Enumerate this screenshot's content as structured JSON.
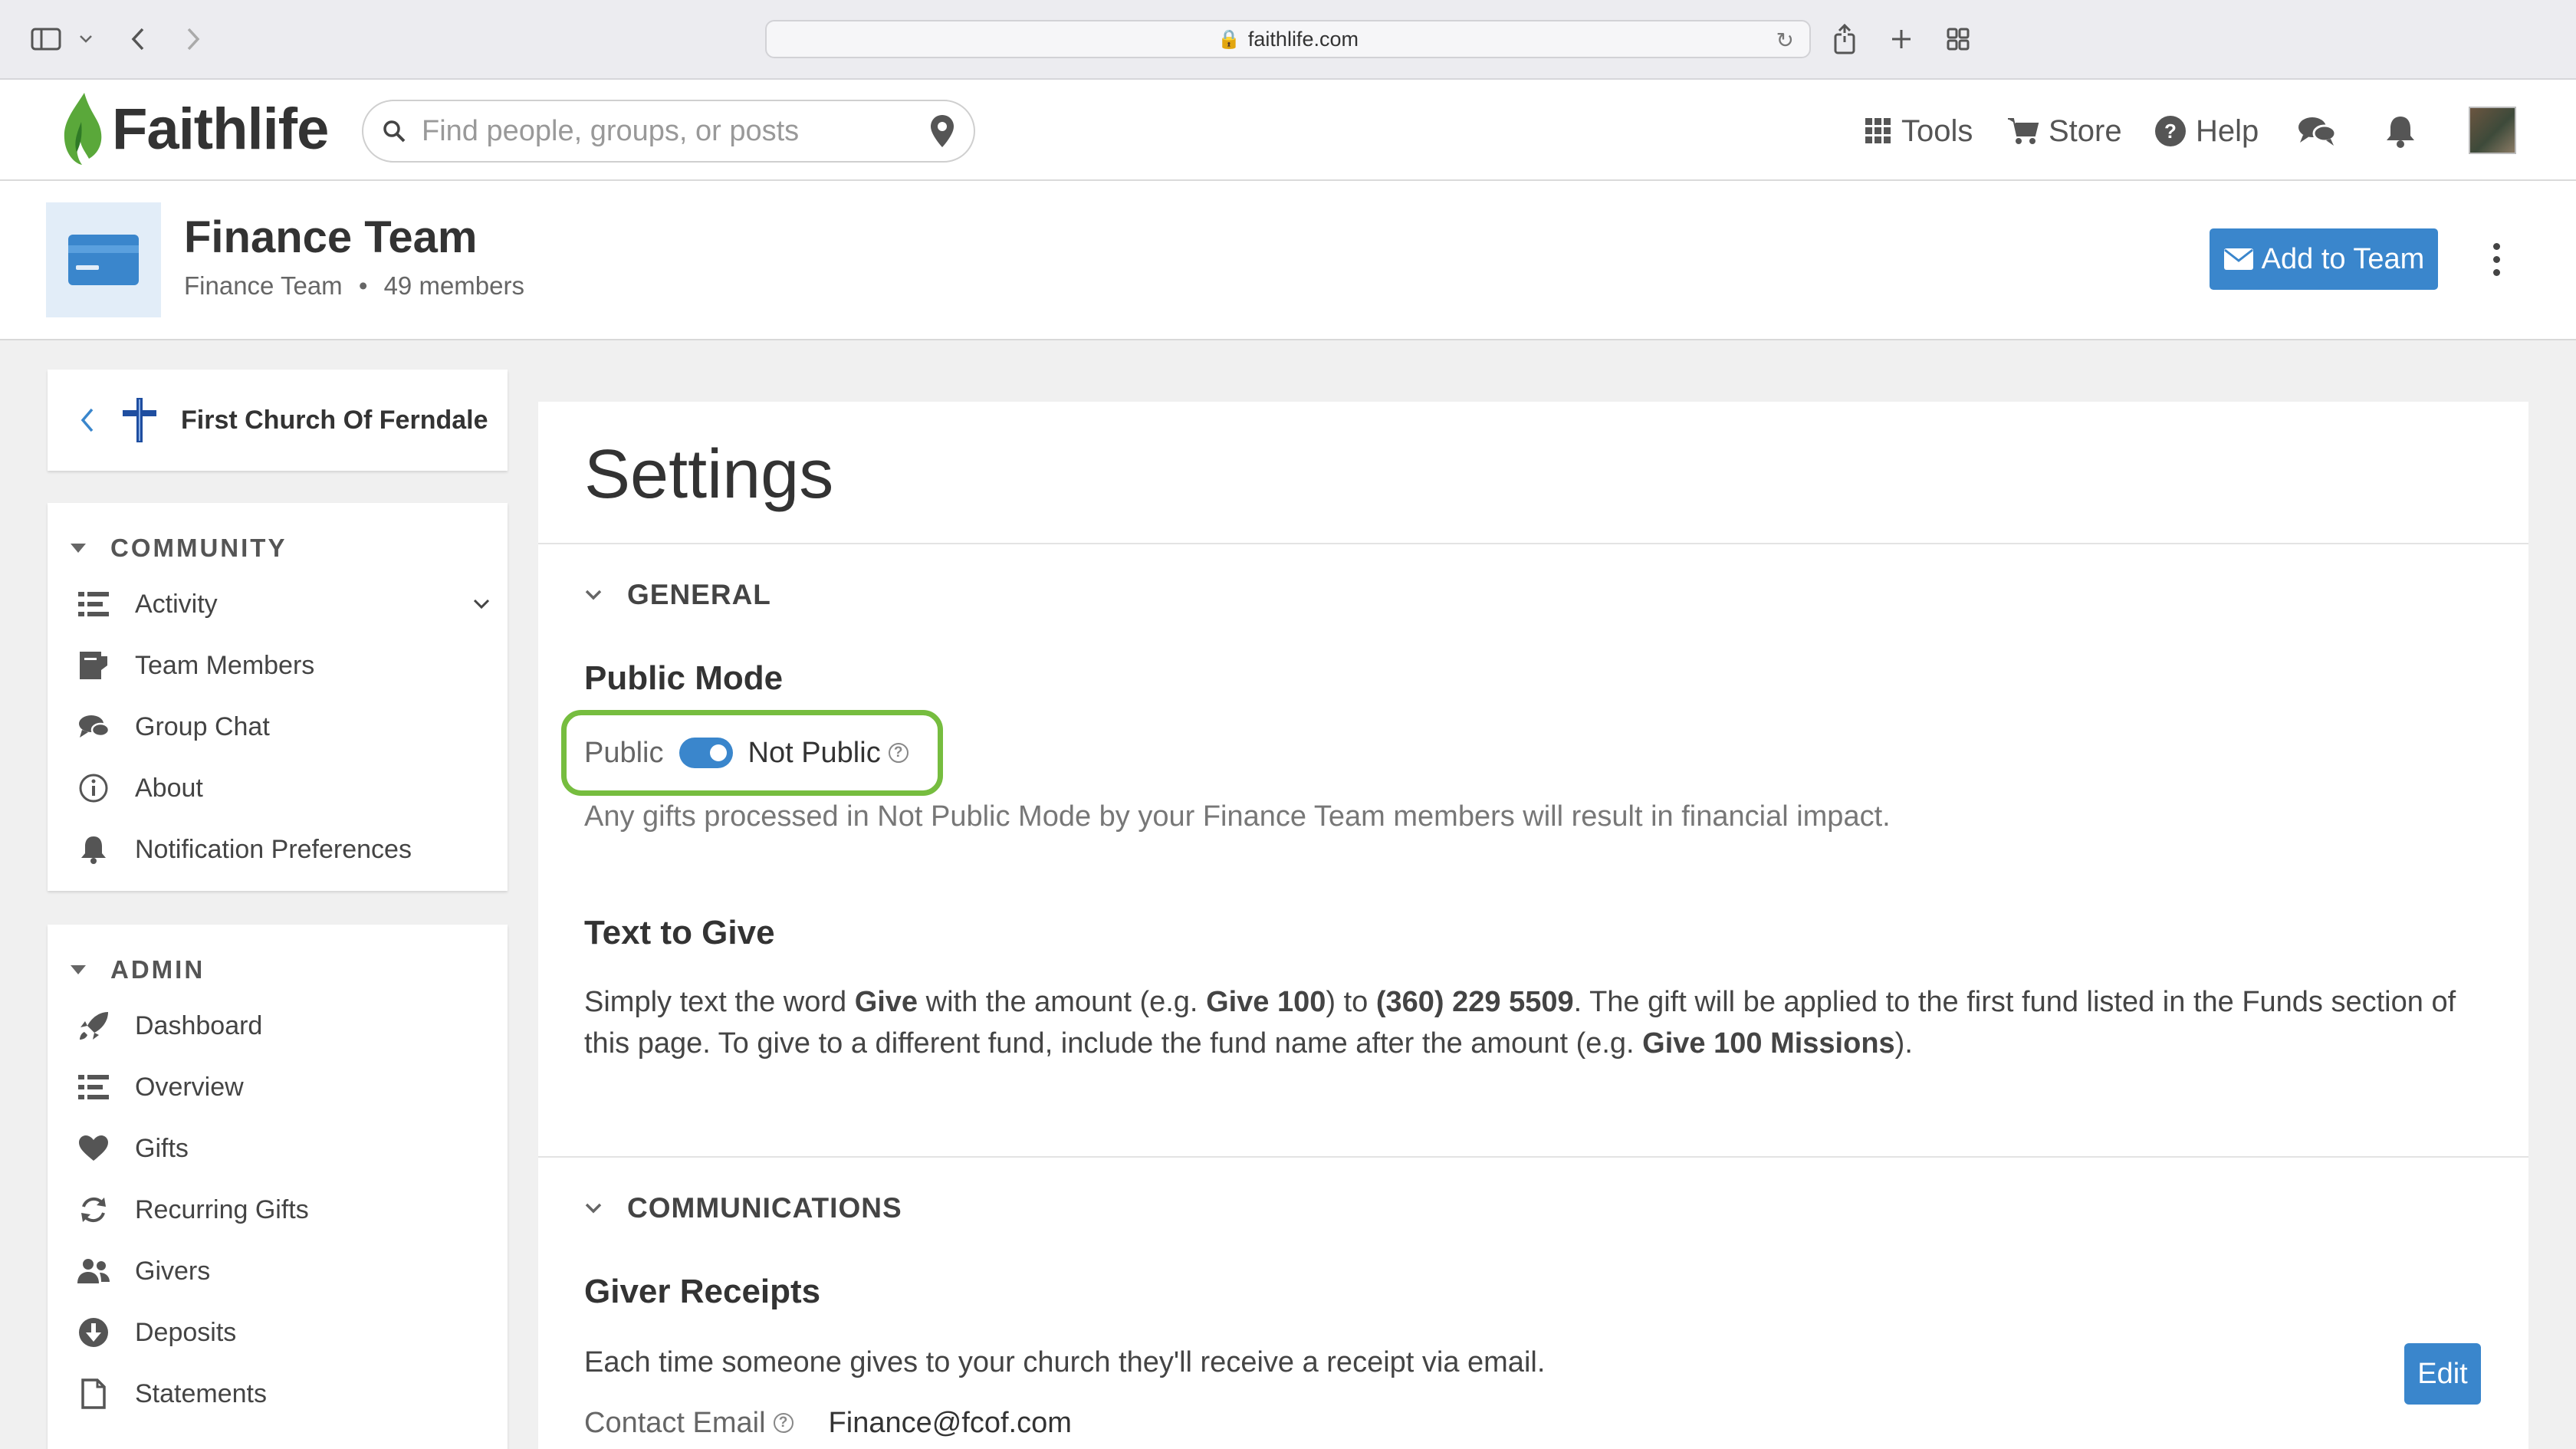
{
  "browser": {
    "url": "faithlife.com"
  },
  "header": {
    "logo_text": "Faithlife",
    "search_placeholder": "Find people, groups, or posts",
    "nav": {
      "tools": "Tools",
      "store": "Store",
      "help": "Help"
    }
  },
  "team": {
    "title": "Finance Team",
    "subtitle_name": "Finance Team",
    "members": "49 members",
    "add_button": "Add to Team"
  },
  "sidebar": {
    "church_name": "First Church Of Ferndale",
    "community_title": "COMMUNITY",
    "community_items": [
      {
        "label": "Activity",
        "icon": "list-icon"
      },
      {
        "label": "Team Members",
        "icon": "members-icon"
      },
      {
        "label": "Group Chat",
        "icon": "chat-icon"
      },
      {
        "label": "About",
        "icon": "info-icon"
      },
      {
        "label": "Notification Preferences",
        "icon": "bell-icon"
      }
    ],
    "admin_title": "ADMIN",
    "admin_items": [
      {
        "label": "Dashboard",
        "icon": "rocket-icon"
      },
      {
        "label": "Overview",
        "icon": "list-icon"
      },
      {
        "label": "Gifts",
        "icon": "heart-icon"
      },
      {
        "label": "Recurring Gifts",
        "icon": "recurring-icon"
      },
      {
        "label": "Givers",
        "icon": "people-icon"
      },
      {
        "label": "Deposits",
        "icon": "deposit-icon"
      },
      {
        "label": "Statements",
        "icon": "document-icon"
      }
    ]
  },
  "main": {
    "title": "Settings",
    "general": {
      "heading": "GENERAL",
      "public_mode_title": "Public Mode",
      "public_label": "Public",
      "not_public_label": "Not Public",
      "public_mode_note": "Any gifts processed in Not Public Mode by your Finance Team members will result in financial impact.",
      "text_to_give_title": "Text to Give",
      "ttg": {
        "p1": "Simply text the word ",
        "b1": "Give",
        "p2": " with the amount (e.g. ",
        "b2": "Give 100",
        "p3": ") to ",
        "b3": "(360) 229 5509",
        "p4": ". The gift will be applied to the first fund listed in the Funds section of this page. To give to a different fund, include the fund name after the amount (e.g. ",
        "b4": "Give 100 Missions",
        "p5": ")."
      }
    },
    "communications": {
      "heading": "COMMUNICATIONS",
      "receipts_title": "Giver Receipts",
      "receipts_text": "Each time someone gives to your church they'll receive a receipt via email.",
      "contact_label": "Contact Email",
      "contact_value": "Finance@fcof.com",
      "edit_button": "Edit"
    }
  },
  "colors": {
    "accent": "#3a86cc",
    "highlight": "#76bd3f",
    "logo_green": "#5aa83a"
  }
}
